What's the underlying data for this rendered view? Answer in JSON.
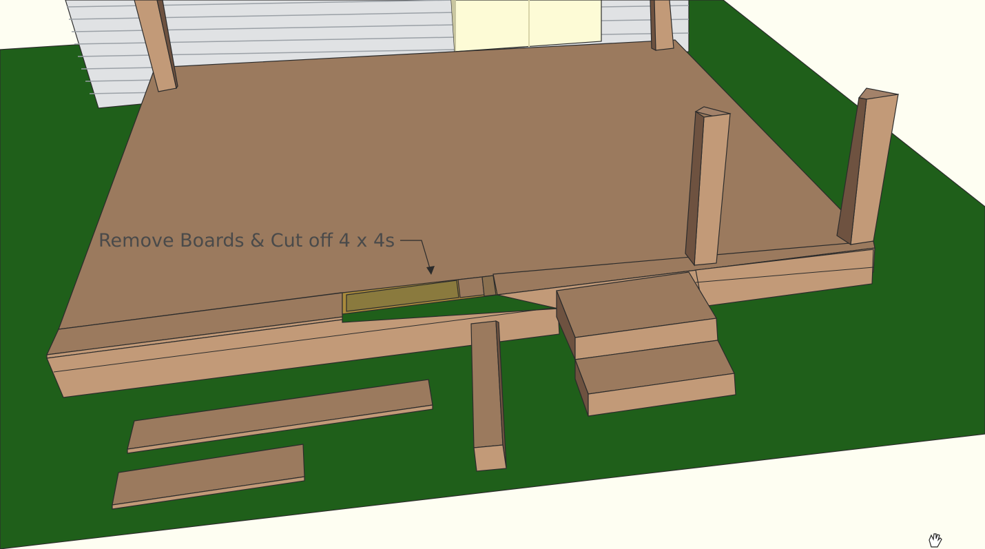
{
  "annotation": {
    "text": "Remove Boards & Cut off 4 x 4s"
  },
  "colors": {
    "background": "#fefef2",
    "lawn": "#1f5f1a",
    "deck_top": "#9b7a5e",
    "deck_light": "#c29a78",
    "deck_dark": "#6e5240",
    "siding": "#e0e2e4",
    "door": "#fdfbd6",
    "highlight": "#a98a3c",
    "edge": "#2b2b2b",
    "annotation_text": "#4a4a4a"
  },
  "icons": {
    "cursor": "hand-pan-cursor-icon"
  }
}
